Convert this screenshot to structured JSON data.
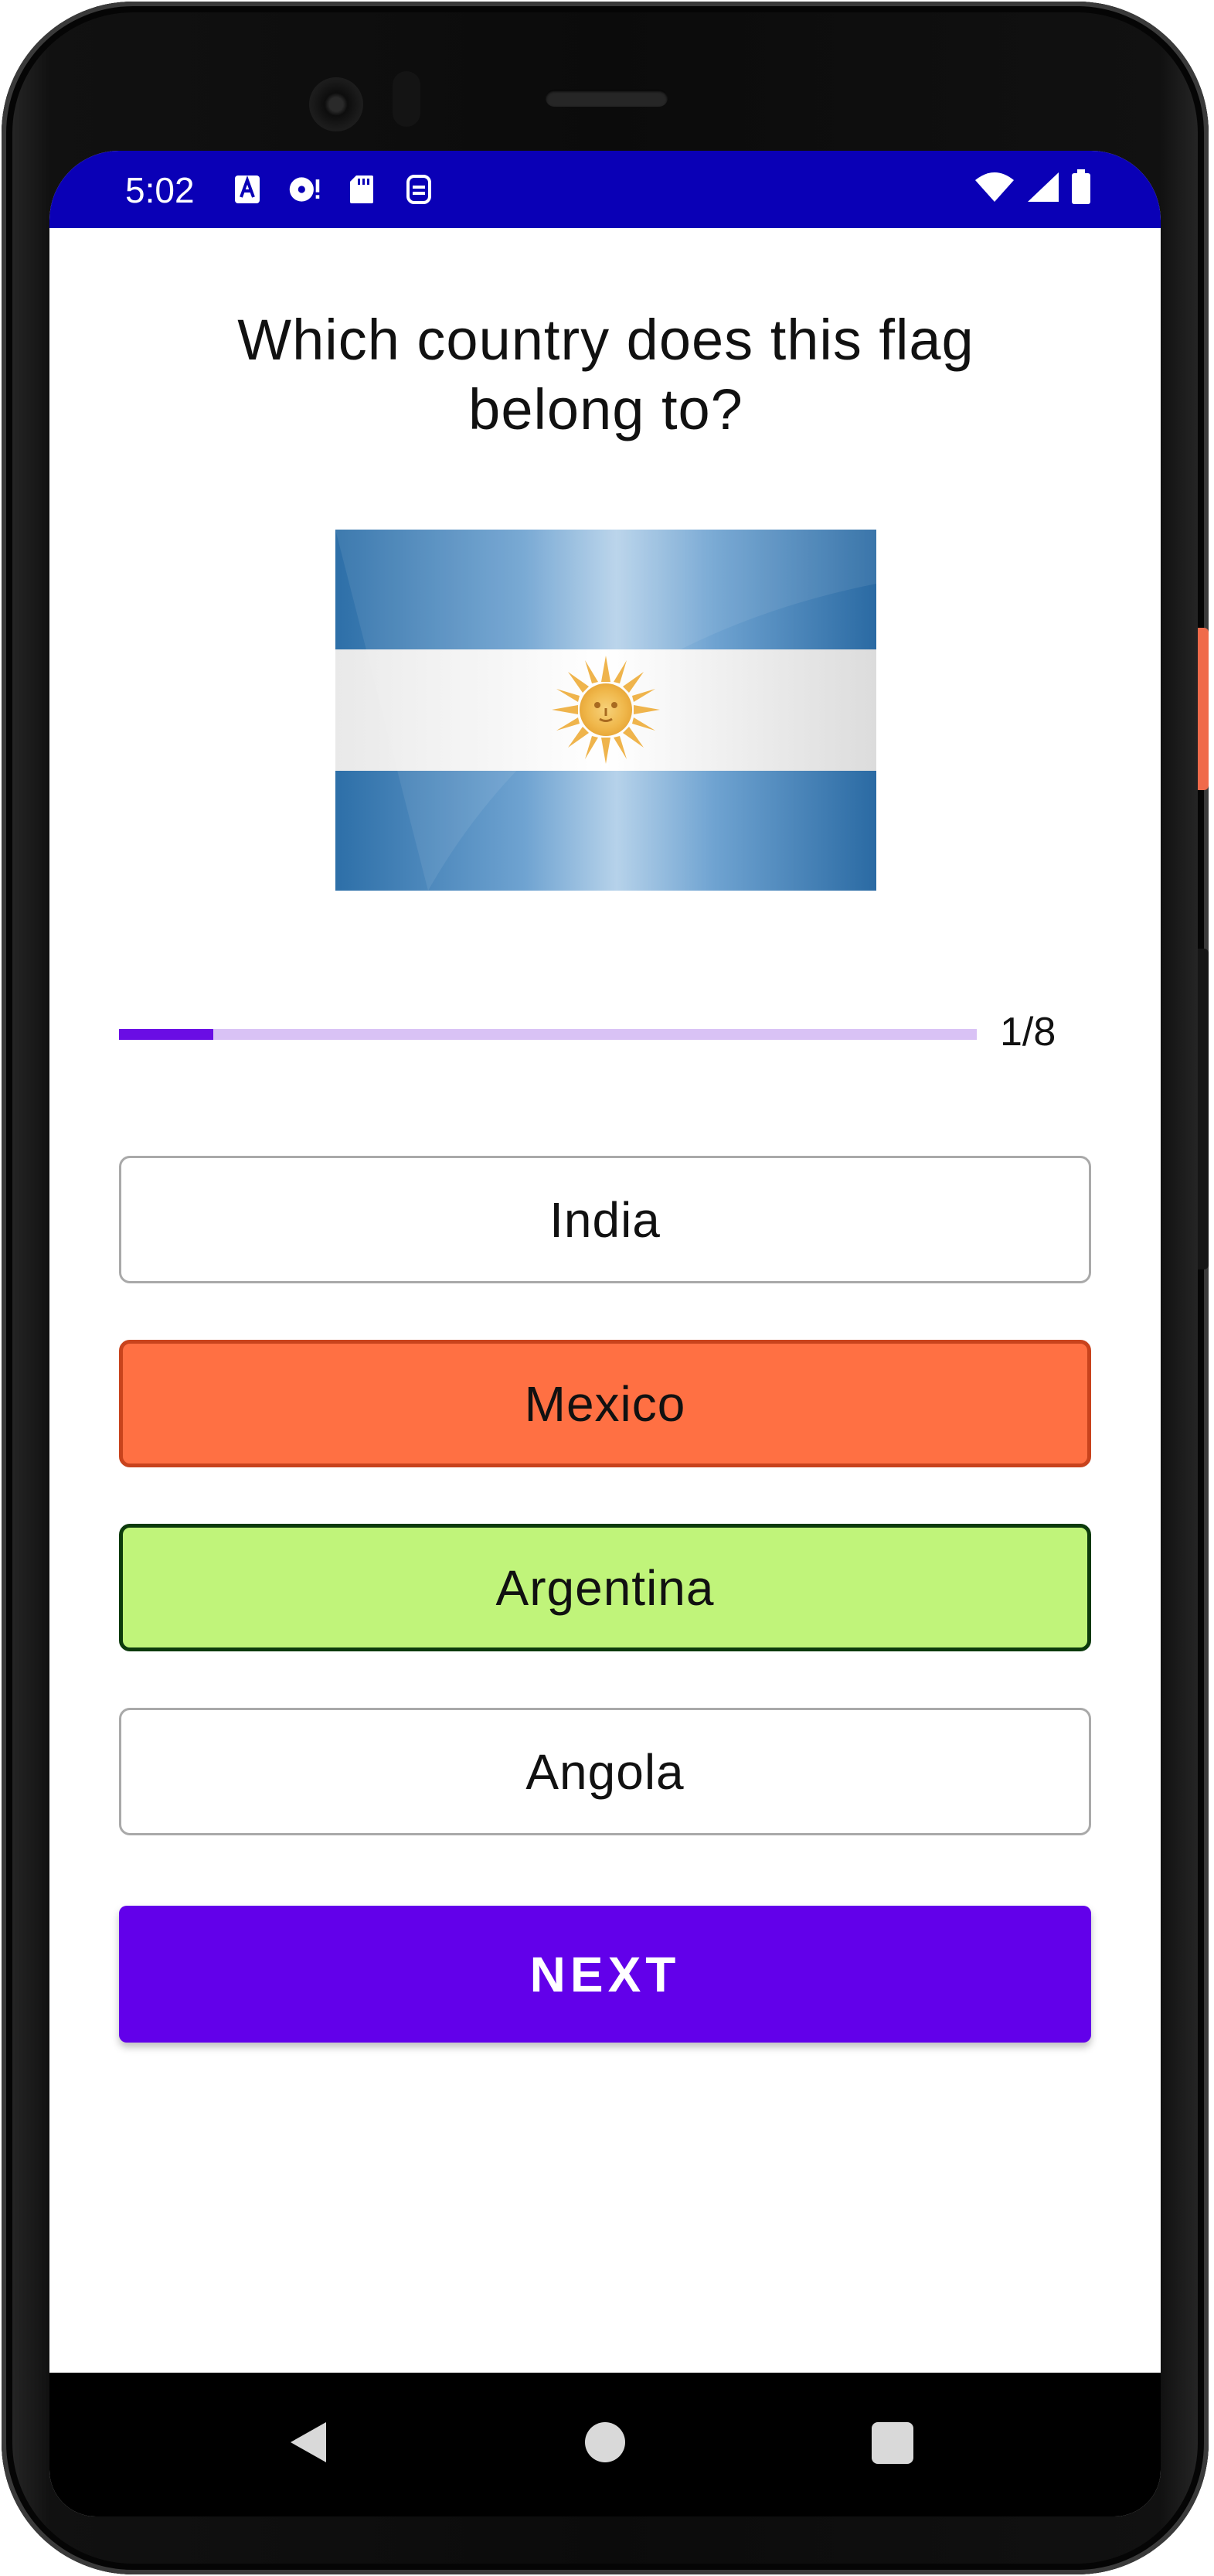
{
  "status_bar": {
    "time": "5:02",
    "left_icons": [
      "text-icon",
      "disc-icon",
      "sd-card-icon",
      "sync-icon"
    ],
    "right_icons": [
      "wifi-icon",
      "signal-icon",
      "battery-icon"
    ],
    "background": "#0a00b6"
  },
  "quiz": {
    "question": "Which country does this flag belong to?",
    "flag_icon": "argentina-flag",
    "progress": {
      "current": 1,
      "total": 8,
      "text": "1/8",
      "fraction": 0.11
    },
    "options": [
      {
        "label": "India",
        "state": "neutral"
      },
      {
        "label": "Mexico",
        "state": "wrong",
        "color": "#ff7043"
      },
      {
        "label": "Argentina",
        "state": "correct",
        "color": "#c0f47a"
      },
      {
        "label": "Angola",
        "state": "neutral"
      }
    ],
    "next_label": "NEXT",
    "accent": "#6200ea"
  },
  "nav_bar": {
    "icons": [
      "back-icon",
      "home-icon",
      "recents-icon"
    ]
  }
}
